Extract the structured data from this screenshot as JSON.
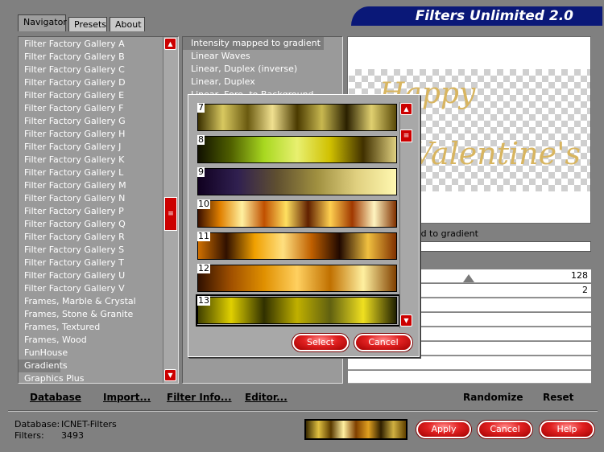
{
  "header": {
    "title": "Filters Unlimited 2.0",
    "tabs": [
      {
        "label": "Navigator"
      },
      {
        "label": "Presets"
      },
      {
        "label": "About"
      }
    ]
  },
  "categories": [
    "Filter Factory Gallery A",
    "Filter Factory Gallery B",
    "Filter Factory Gallery C",
    "Filter Factory Gallery D",
    "Filter Factory Gallery E",
    "Filter Factory Gallery F",
    "Filter Factory Gallery G",
    "Filter Factory Gallery H",
    "Filter Factory Gallery J",
    "Filter Factory Gallery K",
    "Filter Factory Gallery L",
    "Filter Factory Gallery M",
    "Filter Factory Gallery N",
    "Filter Factory Gallery P",
    "Filter Factory Gallery Q",
    "Filter Factory Gallery R",
    "Filter Factory Gallery S",
    "Filter Factory Gallery T",
    "Filter Factory Gallery U",
    "Filter Factory Gallery V",
    "Frames, Marble & Crystal",
    "Frames, Stone & Granite",
    "Frames, Textured",
    "Frames, Wood",
    "FunHouse",
    "Gradients",
    "Graphics Plus"
  ],
  "selected_category": "Gradients",
  "filters": [
    "Intensity mapped to gradient",
    "Linear Waves",
    "Linear, Duplex (inverse)",
    "Linear, Duplex",
    "Linear, Fore- to Background"
  ],
  "selected_filter": "Intensity mapped to gradient",
  "preview": {
    "filter_name": "Intensity mapped to gradient",
    "text_art_lines": [
      "Happy",
      "Valentine's Day"
    ]
  },
  "params": [
    {
      "value": "128",
      "slider_fraction": 0.502
    },
    {
      "value": "2"
    }
  ],
  "bottom_links": {
    "database": "Database",
    "import": "Import...",
    "filter_info": "Filter Info...",
    "editor": "Editor...",
    "randomize": "Randomize",
    "reset": "Reset"
  },
  "footer": {
    "database_label": "Database:",
    "database_value": "ICNET-Filters",
    "filters_label": "Filters:",
    "filters_value": "3493"
  },
  "buttons": {
    "apply": "Apply",
    "cancel": "Cancel",
    "help": "Help"
  },
  "gradient_popup": {
    "items": [
      {
        "num": "7",
        "colors": [
          "#3a3000",
          "#d8c860",
          "#6a5a10",
          "#f0e090",
          "#4a3a00",
          "#c8b850",
          "#2a2000",
          "#e0d070",
          "#5a4a08"
        ]
      },
      {
        "num": "8",
        "colors": [
          "#101000",
          "#506000",
          "#a8d820",
          "#e8f070",
          "#d0c000",
          "#403000",
          "#e0d080"
        ]
      },
      {
        "num": "9",
        "colors": [
          "#100020",
          "#302050",
          "#605030",
          "#a09040",
          "#e0d080",
          "#fff8b0"
        ]
      },
      {
        "num": "10",
        "colors": [
          "#3a1000",
          "#e08000",
          "#fff0a0",
          "#c05000",
          "#ffe060",
          "#602000",
          "#ffd050",
          "#a03800",
          "#fff4c0",
          "#803000"
        ]
      },
      {
        "num": "11",
        "colors": [
          "#d07000",
          "#301000",
          "#f0a000",
          "#ffe080",
          "#c06000",
          "#200800",
          "#f0c040",
          "#803000"
        ]
      },
      {
        "num": "12",
        "colors": [
          "#301000",
          "#a05000",
          "#e09000",
          "#ffd060",
          "#c07000",
          "#fff0a0",
          "#804000"
        ]
      },
      {
        "num": "13",
        "colors": [
          "#404000",
          "#e0d000",
          "#303000",
          "#c0b000",
          "#606010",
          "#f0e020",
          "#202000"
        ]
      }
    ],
    "select_label": "Select",
    "cancel_label": "Cancel"
  },
  "gradient_swatch_colors": [
    "#3a2a00",
    "#e0c040",
    "#5a3a00",
    "#fff0a0",
    "#804000",
    "#e0a020",
    "#302000",
    "#d0b040",
    "#604000"
  ]
}
